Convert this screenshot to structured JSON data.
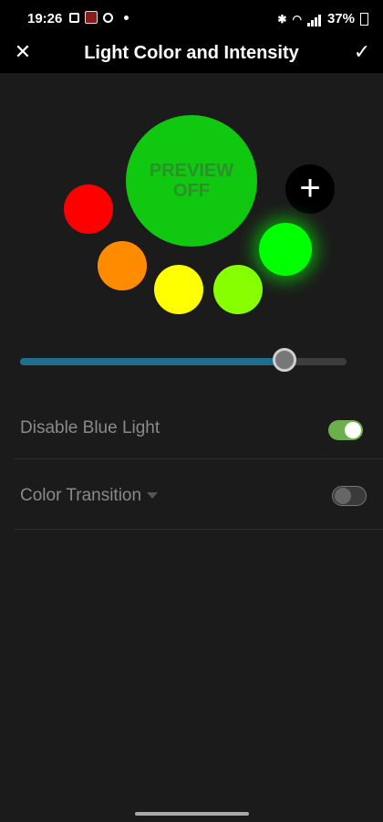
{
  "statusbar": {
    "time": "19:26",
    "battery": "37%"
  },
  "appbar": {
    "title": "Light Color and Intensity",
    "close_icon": "close-icon",
    "confirm_icon": "check-icon"
  },
  "preview": {
    "line1": "PREVIEW",
    "line2": "OFF",
    "color": "#10c810"
  },
  "swatches": {
    "red": "#ff0000",
    "orange": "#ff8c00",
    "yellow": "#ffff00",
    "lime": "#88ff00",
    "green_selected": "#00ff00"
  },
  "add_button": {
    "symbol": "+"
  },
  "intensity": {
    "value_fraction": 0.81
  },
  "settings": {
    "disable_blue_light": {
      "label": "Disable Blue Light",
      "on": true
    },
    "color_transition": {
      "label": "Color Transition",
      "on": false
    }
  }
}
